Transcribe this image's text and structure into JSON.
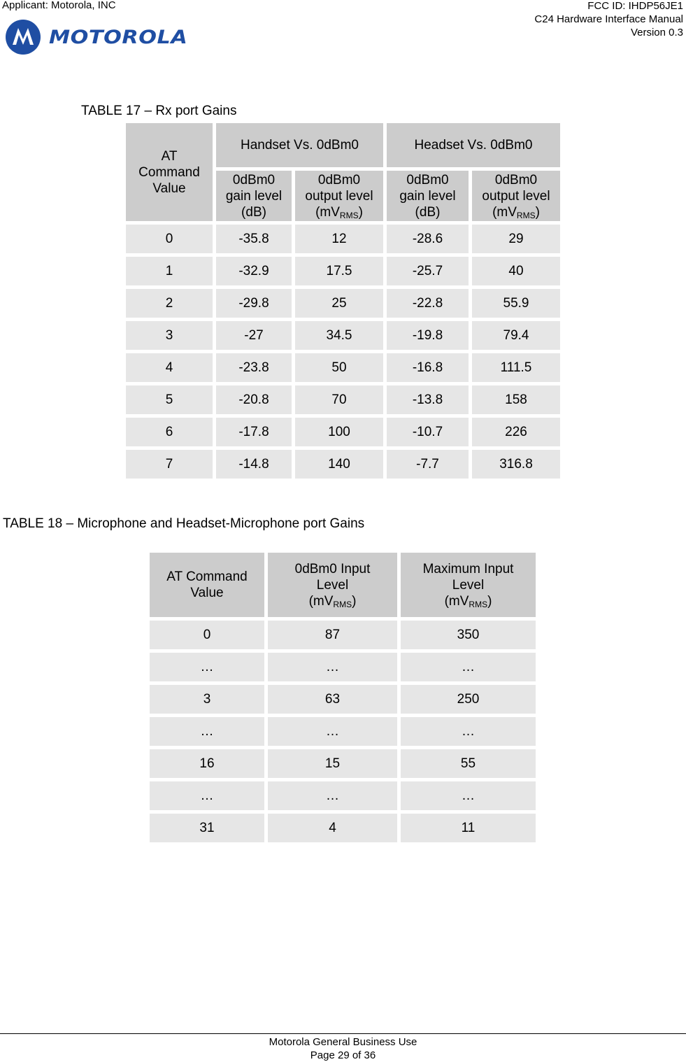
{
  "header": {
    "applicant": "Applicant: Motorola, INC",
    "fcc_id": "FCC ID: IHDP56JE1",
    "doc_title": "C24 Hardware Interface Manual",
    "version": "Version 0.3",
    "logo_text": "MOTOROLA",
    "logo_icon": "motorola-batwing-logo",
    "brand_color": "#1f4ea3"
  },
  "table17": {
    "caption": "TABLE 17 – Rx port Gains",
    "headers": {
      "at_command": "AT Command Value",
      "group_handset": "Handset Vs. 0dBm0",
      "group_headset": "Headset Vs. 0dBm0",
      "gain_line1": "0dBm0",
      "gain_line2": "gain level",
      "gain_line3": "(dB)",
      "output_line1": "0dBm0",
      "output_line2": "output level",
      "output_unit": "(mV",
      "output_sub": "RMS",
      "output_close": ")"
    },
    "rows": [
      [
        "0",
        "-35.8",
        "12",
        "-28.6",
        "29"
      ],
      [
        "1",
        "-32.9",
        "17.5",
        "-25.7",
        "40"
      ],
      [
        "2",
        "-29.8",
        "25",
        "-22.8",
        "55.9"
      ],
      [
        "3",
        "-27",
        "34.5",
        "-19.8",
        "79.4"
      ],
      [
        "4",
        "-23.8",
        "50",
        "-16.8",
        "111.5"
      ],
      [
        "5",
        "-20.8",
        "70",
        "-13.8",
        "158"
      ],
      [
        "6",
        "-17.8",
        "100",
        "-10.7",
        "226"
      ],
      [
        "7",
        "-14.8",
        "140",
        "-7.7",
        "316.8"
      ]
    ]
  },
  "table18": {
    "caption": "TABLE 18 – Microphone and Headset-Microphone port Gains",
    "headers": {
      "at_command": "AT Command Value",
      "input_line1": "0dBm0 Input",
      "input_line2": "Level",
      "max_line1": "Maximum Input",
      "max_line2": "Level",
      "unit": "(mV",
      "unit_sub": "RMS",
      "unit_close": ")"
    },
    "rows": [
      [
        "0",
        "87",
        "350"
      ],
      [
        "…",
        "…",
        "…"
      ],
      [
        "3",
        "63",
        "250"
      ],
      [
        "…",
        "…",
        "…"
      ],
      [
        "16",
        "15",
        "55"
      ],
      [
        "…",
        "…",
        "…"
      ],
      [
        "31",
        "4",
        "11"
      ]
    ]
  },
  "footer": {
    "classification": "Motorola General Business Use",
    "page": "Page 29 of 36"
  }
}
